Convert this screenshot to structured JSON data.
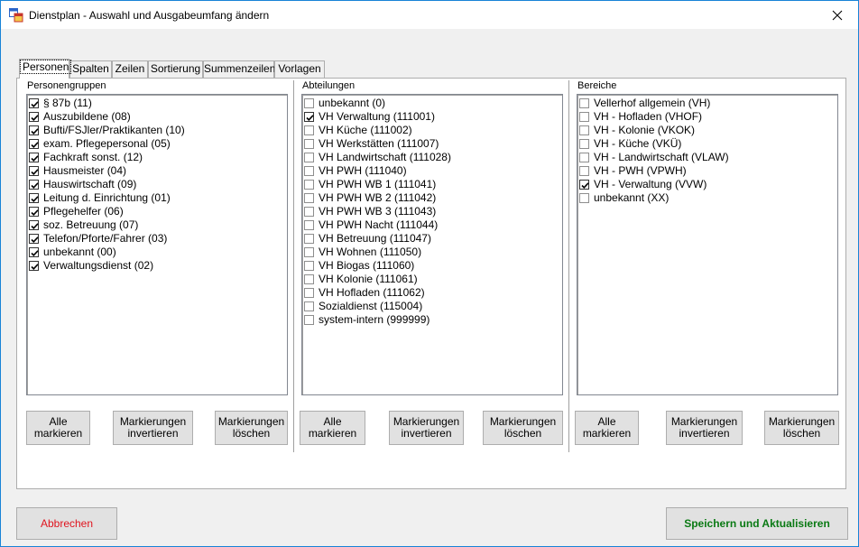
{
  "window": {
    "title": "Dienstplan - Auswahl und Ausgabeumfang  ändern"
  },
  "tabs": [
    {
      "label": "Personen",
      "active": true
    },
    {
      "label": "Spalten"
    },
    {
      "label": "Zeilen"
    },
    {
      "label": "Sortierung"
    },
    {
      "label": "Summenzeilen"
    },
    {
      "label": "Vorlagen"
    }
  ],
  "groups": [
    {
      "label": "Personengruppen",
      "items": [
        {
          "label": "§ 87b (11)",
          "checked": true
        },
        {
          "label": "Auszubildene (08)",
          "checked": true
        },
        {
          "label": "Bufti/FSJler/Praktikanten (10)",
          "checked": true
        },
        {
          "label": "exam. Pflegepersonal (05)",
          "checked": true
        },
        {
          "label": "Fachkraft sonst. (12)",
          "checked": true
        },
        {
          "label": "Hausmeister (04)",
          "checked": true
        },
        {
          "label": "Hauswirtschaft (09)",
          "checked": true
        },
        {
          "label": "Leitung d. Einrichtung (01)",
          "checked": true
        },
        {
          "label": "Pflegehelfer (06)",
          "checked": true
        },
        {
          "label": "soz. Betreuung (07)",
          "checked": true
        },
        {
          "label": "Telefon/Pforte/Fahrer (03)",
          "checked": true
        },
        {
          "label": "unbekannt (00)",
          "checked": true
        },
        {
          "label": "Verwaltungsdienst (02)",
          "checked": true
        }
      ]
    },
    {
      "label": "Abteilungen",
      "items": [
        {
          "label": "unbekannt (0)",
          "checked": false
        },
        {
          "label": "VH Verwaltung (111001)",
          "checked": true
        },
        {
          "label": "VH Küche (111002)",
          "checked": false
        },
        {
          "label": "VH Werkstätten (111007)",
          "checked": false
        },
        {
          "label": "VH Landwirtschaft (111028)",
          "checked": false
        },
        {
          "label": "VH PWH (111040)",
          "checked": false
        },
        {
          "label": "VH PWH WB 1 (111041)",
          "checked": false
        },
        {
          "label": "VH PWH WB 2 (111042)",
          "checked": false
        },
        {
          "label": "VH PWH WB 3 (111043)",
          "checked": false
        },
        {
          "label": "VH PWH Nacht (111044)",
          "checked": false
        },
        {
          "label": "VH Betreuung (111047)",
          "checked": false
        },
        {
          "label": "VH Wohnen (111050)",
          "checked": false
        },
        {
          "label": "VH Biogas (111060)",
          "checked": false
        },
        {
          "label": "VH Kolonie (111061)",
          "checked": false
        },
        {
          "label": "VH Hofladen (111062)",
          "checked": false
        },
        {
          "label": "Sozialdienst (115004)",
          "checked": false
        },
        {
          "label": "system-intern (999999)",
          "checked": false
        }
      ]
    },
    {
      "label": "Bereiche",
      "items": [
        {
          "label": "Vellerhof allgemein (VH)",
          "checked": false
        },
        {
          "label": "VH - Hofladen (VHOF)",
          "checked": false
        },
        {
          "label": "VH - Kolonie (VKOK)",
          "checked": false
        },
        {
          "label": "VH - Küche (VKÜ)",
          "checked": false
        },
        {
          "label": "VH - Landwirtschaft (VLAW)",
          "checked": false
        },
        {
          "label": "VH - PWH (VPWH)",
          "checked": false
        },
        {
          "label": "VH - Verwaltung (VVW)",
          "checked": true
        },
        {
          "label": "unbekannt (XX)",
          "checked": false
        }
      ]
    }
  ],
  "group_buttons": {
    "select_all": "Alle\nmarkieren",
    "invert": "Markierungen\ninvertieren",
    "clear": "Markierungen\nlöschen"
  },
  "footer": {
    "cancel_label": "Abbrechen",
    "save_label": "Speichern und Aktualisieren"
  },
  "colors": {
    "cancel_text": "#e0141e",
    "save_text": "#0a7a14",
    "window_border": "#1883d7"
  }
}
